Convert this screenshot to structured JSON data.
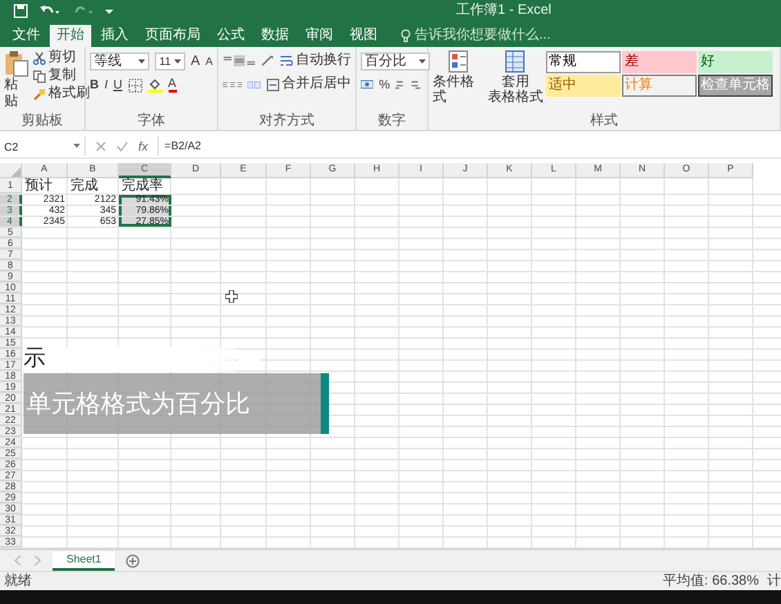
{
  "window": {
    "title": "工作簿1 - Excel"
  },
  "ribbon_tabs": [
    {
      "label": "文件",
      "selected": false
    },
    {
      "label": "开始",
      "selected": true
    },
    {
      "label": "插入",
      "selected": false
    },
    {
      "label": "页面布局",
      "selected": false
    },
    {
      "label": "公式",
      "selected": false
    },
    {
      "label": "数据",
      "selected": false
    },
    {
      "label": "审阅",
      "selected": false
    },
    {
      "label": "视图",
      "selected": false
    }
  ],
  "tell_me": {
    "placeholder": "告诉我你想要做什么..."
  },
  "clipboard": {
    "paste": "粘贴",
    "cut": "剪切",
    "copy": "复制",
    "format_painter": "格式刷",
    "label": "剪贴板"
  },
  "font": {
    "name": "等线",
    "size": "11",
    "grow": "A",
    "shrink": "A",
    "buttons": [
      "B",
      "I",
      "U"
    ],
    "font_color": "A",
    "label": "字体"
  },
  "alignment": {
    "wrap_text": "自动换行",
    "merge": "合并后居中",
    "label": "对齐方式"
  },
  "number": {
    "format": "百分比",
    "percent": "%",
    "label": "数字"
  },
  "styles": {
    "conditional": "条件格式",
    "table_format": [
      "套用",
      "表格格式"
    ],
    "label": "样式",
    "cell_styles": [
      {
        "label": "常规",
        "kind": "normal"
      },
      {
        "label": "差",
        "kind": "bad"
      },
      {
        "label": "好",
        "kind": "good"
      },
      {
        "label": "适中",
        "kind": "neutral"
      },
      {
        "label": "计算",
        "kind": "calculation"
      },
      {
        "label": "检查单元格",
        "kind": "check"
      }
    ]
  },
  "formula_bar": {
    "name_box": "C2",
    "fx": "fx",
    "formula": "=B2/A2"
  },
  "sheet": {
    "columns": [
      {
        "label": "A",
        "selected": false
      },
      {
        "label": "B",
        "selected": false
      },
      {
        "label": "C",
        "selected": true
      },
      {
        "label": "D",
        "selected": false
      },
      {
        "label": "E",
        "selected": false
      },
      {
        "label": "F",
        "selected": false
      },
      {
        "label": "G",
        "selected": false
      },
      {
        "label": "H",
        "selected": false
      },
      {
        "label": "I",
        "selected": false
      },
      {
        "label": "J",
        "selected": false
      },
      {
        "label": "K",
        "selected": false
      },
      {
        "label": "L",
        "selected": false
      },
      {
        "label": "M",
        "selected": false
      },
      {
        "label": "N",
        "selected": false
      },
      {
        "label": "O",
        "selected": false
      },
      {
        "label": "P",
        "selected": false
      }
    ],
    "rows": [
      {
        "label": "1",
        "selected": false,
        "kind": "text",
        "cells": [
          {
            "text": "预计",
            "selected": false
          },
          {
            "text": "完成",
            "selected": false
          },
          {
            "text": "完成率",
            "selected": false
          }
        ]
      },
      {
        "label": "2",
        "selected": true,
        "kind": "number",
        "cells": [
          {
            "text": "2321",
            "selected": false
          },
          {
            "text": "2122",
            "selected": false
          },
          {
            "text": "91.43%",
            "selected": true
          }
        ]
      },
      {
        "label": "3",
        "selected": true,
        "kind": "number",
        "cells": [
          {
            "text": "432",
            "selected": false
          },
          {
            "text": "345",
            "selected": false
          },
          {
            "text": "79.86%",
            "selected": true
          }
        ]
      },
      {
        "label": "4",
        "selected": true,
        "kind": "number",
        "cells": [
          {
            "text": "2345",
            "selected": false
          },
          {
            "text": "653",
            "selected": false
          },
          {
            "text": "27.85%",
            "selected": true
          }
        ]
      },
      {
        "label": "5",
        "selected": false
      },
      {
        "label": "6",
        "selected": false
      },
      {
        "label": "7",
        "selected": false
      },
      {
        "label": "8",
        "selected": false
      },
      {
        "label": "9",
        "selected": false
      },
      {
        "label": "10",
        "selected": false
      },
      {
        "label": "11",
        "selected": false
      },
      {
        "label": "12",
        "selected": false
      },
      {
        "label": "13",
        "selected": false
      },
      {
        "label": "14",
        "selected": false
      },
      {
        "label": "15",
        "selected": false
      },
      {
        "label": "16",
        "selected": false
      },
      {
        "label": "17",
        "selected": false
      },
      {
        "label": "18",
        "selected": false
      },
      {
        "label": "19",
        "selected": false
      },
      {
        "label": "20",
        "selected": false
      },
      {
        "label": "21",
        "selected": false
      },
      {
        "label": "22",
        "selected": false
      },
      {
        "label": "23",
        "selected": false
      },
      {
        "label": "24",
        "selected": false
      },
      {
        "label": "25",
        "selected": false
      },
      {
        "label": "26",
        "selected": false
      },
      {
        "label": "27",
        "selected": false
      },
      {
        "label": "28",
        "selected": false
      },
      {
        "label": "29",
        "selected": false
      },
      {
        "label": "30",
        "selected": false
      },
      {
        "label": "31",
        "selected": false
      },
      {
        "label": "32",
        "selected": false
      },
      {
        "label": "33",
        "selected": false
      }
    ]
  },
  "sheet_tabs": [
    {
      "label": "Sheet1",
      "selected": true
    }
  ],
  "status_bar": {
    "status": "就绪",
    "average": "平均值: 66.38%",
    "count": "计"
  },
  "caption": {
    "fragment": "示",
    "text": "单元格格式为百分比"
  }
}
